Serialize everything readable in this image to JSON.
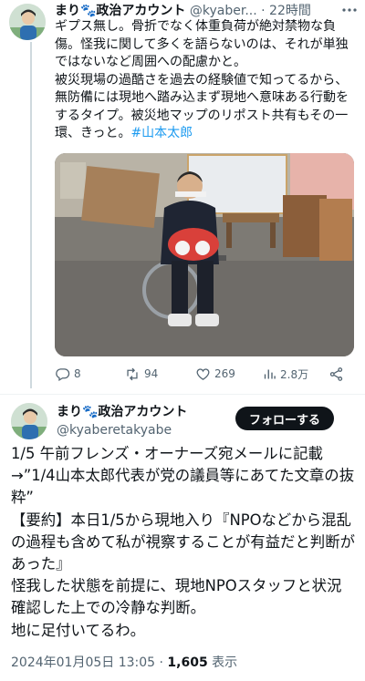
{
  "reply_tweet": {
    "author_name": "まり🐾政治アカウント",
    "handle": "@kyaber...",
    "separator": "·",
    "time": "22時間",
    "body_lines": [
      "ギプス無し。骨折でなく体重負荷が絶対禁物な負傷。怪我に関して多くを語らないのは、それが単独ではないなど周囲への配慮かと。",
      "被災現場の過酷さを過去の経験値で知ってるから、無防備には現地へ踏み込まず現地へ意味ある行動をするタイプ。被災地マップのリポスト共有もその一環、きっと。"
    ],
    "hashtag": "#山本太郎",
    "photo_alt": "車椅子に座る男性の写真",
    "replies": "8",
    "reposts": "94",
    "likes": "269",
    "views": "2.8万"
  },
  "main_tweet": {
    "author_name": "まり🐾政治アカウント",
    "handle": "@kyaberetakyabe",
    "follow_label": "フォローする",
    "body_lines": [
      "1/5 午前フレンズ・オーナーズ宛メールに記載→”1/4山本太郎代表が党の議員等にあてた文章の抜粋”",
      "【要約】本日1/5から現地入り『NPOなどから混乱の過程も含めて私が視察することが有益だと判断があった』",
      "怪我した状態を前提に、現地NPOスタッフと状況確認した上での冷静な判断。",
      "地に足付いてるわ。"
    ],
    "timestamp": "2024年01月05日 13:05",
    "separator": "·",
    "view_count": "1,605",
    "view_label": "表示"
  },
  "colors": {
    "accent": "#1d9bf0",
    "muted": "#536471",
    "follow_bg": "#0f1419"
  },
  "icons": [
    "reply-icon",
    "repost-icon",
    "like-icon",
    "views-icon",
    "share-icon",
    "more-icon"
  ]
}
